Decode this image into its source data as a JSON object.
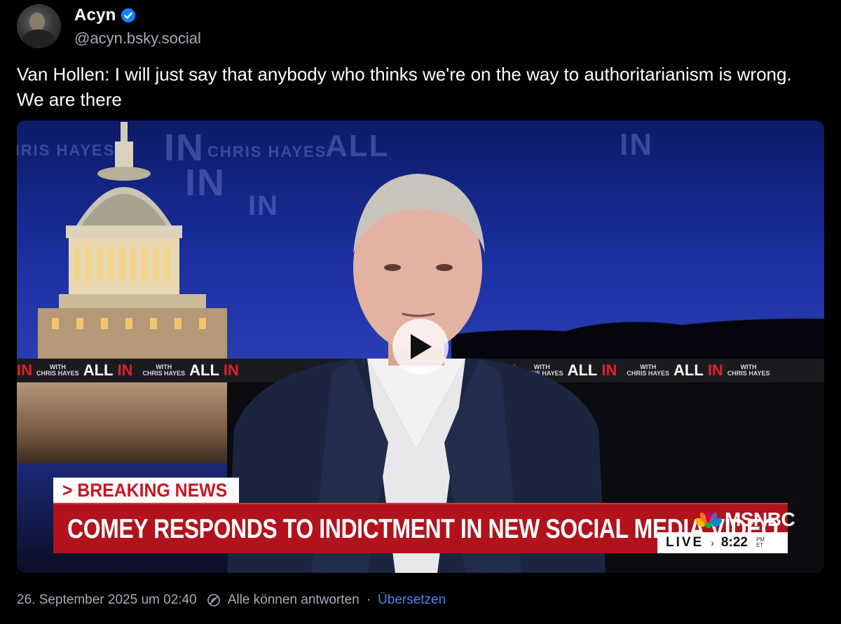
{
  "author": {
    "display_name": "Acyn",
    "handle": "@acyn.bsky.social",
    "verified_color": "#1083fe"
  },
  "post": {
    "text": "Van Hollen: I will just say that anybody who thinks we're on the way to authoritarianism is wrong. We are there"
  },
  "video": {
    "breaking_label": "> BREAKING NEWS",
    "headline": "COMEY RESPONDS TO INDICTMENT IN NEW SOCIAL MEDIA VIDEO",
    "network": "MSNBC",
    "live_label": "LIVE",
    "live_arrow": "›",
    "time": "8:22",
    "time_ampm": "PM",
    "time_zone": "ET",
    "strip_with": "WITH",
    "strip_host": "CHRIS HAYES",
    "strip_all": "ALL",
    "strip_in": "IN",
    "colors": {
      "breaking_red": "#c81622",
      "bar_red": "#b1121c"
    }
  },
  "footer": {
    "date": "26. September 2025 um 02:40",
    "reply_setting": "Alle können antworten",
    "separator": "·",
    "translate_label": "Übersetzen"
  }
}
